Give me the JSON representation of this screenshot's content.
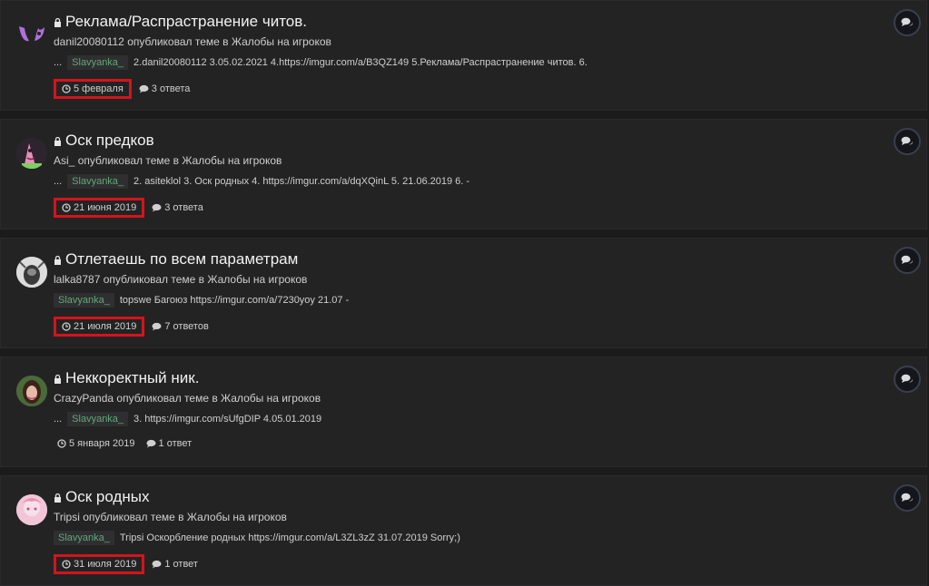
{
  "topics": [
    {
      "title": "Реклама/Распрастранение читов.",
      "author": "danil20080112",
      "meta_text": "опубликовал теме в Жалобы на игроков",
      "snippet_prefix": "...",
      "quote_user": "Slavyanka_",
      "snippet": "2.danil20080112 3.05.02.2021 4.https://imgur.com/a/B3QZ149 5.Реклама/Распрастранение читов. 6.",
      "date": "5 февраля",
      "replies": "3 ответа",
      "highlighted": true
    },
    {
      "title": "Оск предков",
      "author": "Asi_",
      "meta_text": "опубликовал теме в Жалобы на игроков",
      "snippet_prefix": "...",
      "quote_user": "Slavyanka_",
      "snippet": "2. asiteklol 3. Оск родных 4. https://imgur.com/a/dqXQinL 5. 21.06.2019 6. -",
      "date": "21 июня 2019",
      "replies": "3 ответа",
      "highlighted": true
    },
    {
      "title": "Отлетаешь по всем параметрам",
      "author": "lalka8787",
      "meta_text": "опубликовал теме в Жалобы на игроков",
      "snippet_prefix": "",
      "quote_user": "Slavyanka_",
      "snippet": "topswe Багоюз https://imgur.com/a/7230yoy 21.07 -",
      "date": "21 июля 2019",
      "replies": "7 ответов",
      "highlighted": true
    },
    {
      "title": "Неккоректный ник.",
      "author": "CrazyPanda",
      "meta_text": "опубликовал теме в Жалобы на игроков",
      "snippet_prefix": "...",
      "quote_user": "Slavyanka_",
      "snippet": "3. https://imgur.com/sUfgDIP 4.05.01.2019",
      "date": "5 января 2019",
      "replies": "1 ответ",
      "highlighted": false
    },
    {
      "title": "Оск родных",
      "author": "Tripsi",
      "meta_text": "опубликовал теме в Жалобы на игроков",
      "snippet_prefix": "",
      "quote_user": "Slavyanka_",
      "snippet": "Tripsi Оскорбление родных https://imgur.com/a/L3ZL3zZ 31.07.2019 Sorry;)",
      "date": "31 июля 2019",
      "replies": "1 ответ",
      "highlighted": true
    }
  ],
  "icons": {
    "lock": "lock-icon",
    "clock": "clock-icon",
    "comment": "comment-icon",
    "action": "comments-icon"
  },
  "colors": {
    "highlight": "#d4141c",
    "quote_user": "#5fa97a",
    "background": "#1b1b1c",
    "card": "#232324"
  }
}
